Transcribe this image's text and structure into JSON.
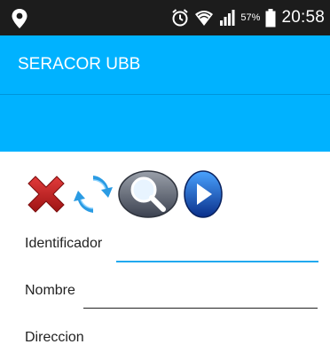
{
  "status_bar": {
    "battery_percent": "57%",
    "time": "20:58",
    "icons": [
      "location-pin-icon",
      "alarm-icon",
      "wifi-icon",
      "signal-icon",
      "battery-icon"
    ]
  },
  "app_bar": {
    "title": "SERACOR UBB",
    "background_color": "#00b2ff"
  },
  "toolbar": {
    "buttons": [
      {
        "icon": "delete-x-icon"
      },
      {
        "icon": "refresh-icon"
      },
      {
        "icon": "search-magnifier-icon"
      },
      {
        "icon": "next-play-icon"
      }
    ]
  },
  "form": {
    "fields": [
      {
        "label": "Identificador",
        "value": "",
        "focused": true
      },
      {
        "label": "Nombre",
        "value": "",
        "focused": false
      },
      {
        "label": "Direccion",
        "value": "",
        "focused": false
      }
    ],
    "accent_color": "#21a9ef"
  }
}
